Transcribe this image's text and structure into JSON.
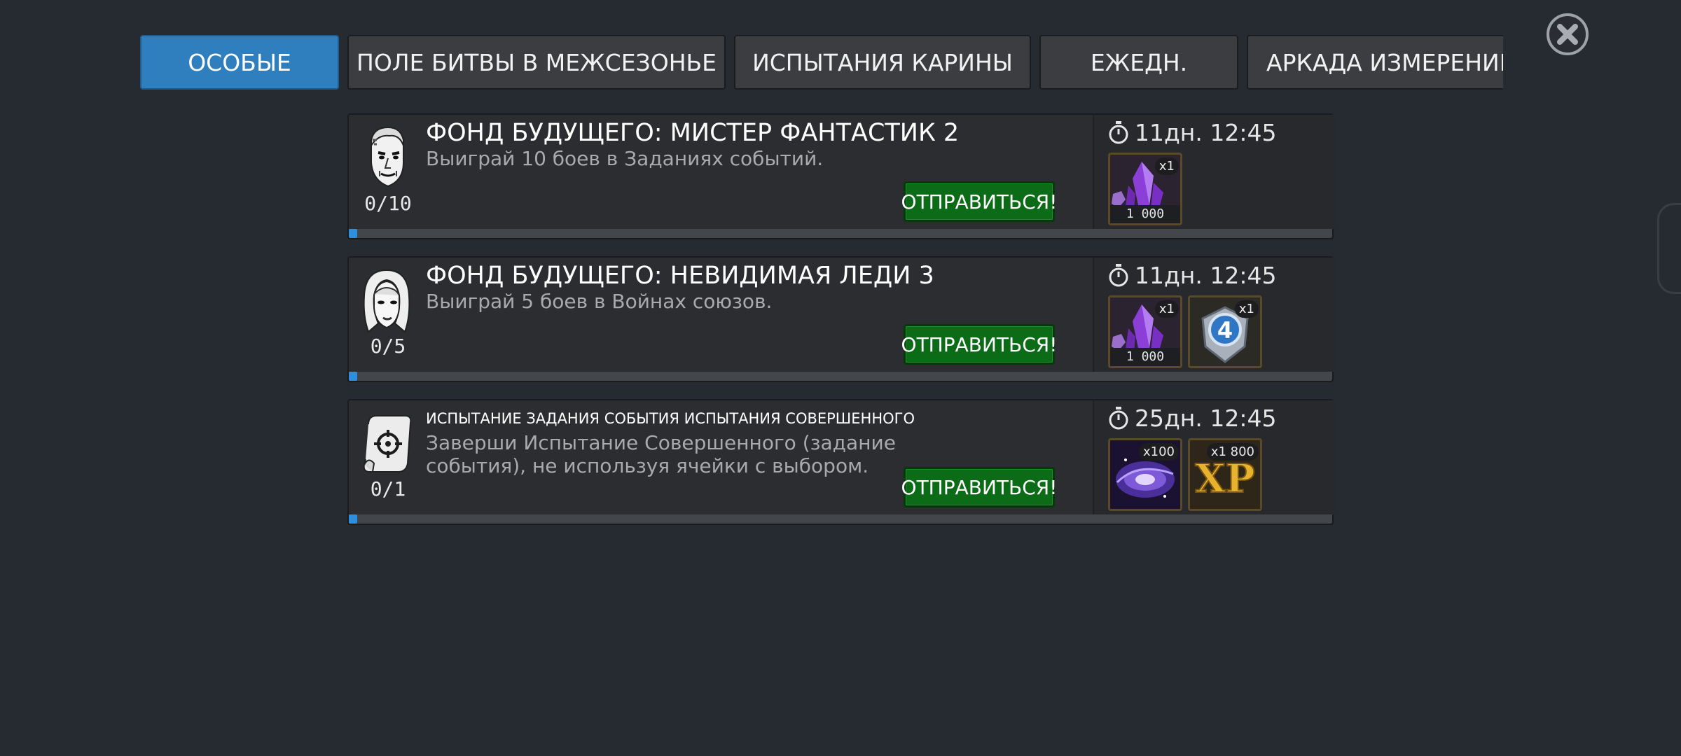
{
  "tabs": [
    {
      "label": "ОСОБЫЕ",
      "active": true
    },
    {
      "label": "ПОЛЕ БИТВЫ В МЕЖСЕЗОНЬЕ",
      "active": false
    },
    {
      "label": "ИСПЫТАНИЯ КАРИНЫ",
      "active": false
    },
    {
      "label": "ЕЖЕДН.",
      "active": false
    },
    {
      "label": "АРКАДА ИЗМЕРЕНИЙ",
      "active": false
    }
  ],
  "close_icon": "close-icon",
  "colors": {
    "accent": "#2f7fbf",
    "go_button": "#0c6b17",
    "progress": "#2d8fe0"
  },
  "quests": [
    {
      "title": "ФОНД БУДУЩЕГО: МИСТЕР ФАНТАСТИК 2",
      "description": "Выиграй 10 боев в Заданиях событий.",
      "progress": "0/10",
      "progress_fraction": 0.0,
      "go_label": "ОТПРАВИТЬСЯ!",
      "timer": "11дн. 12:45",
      "icon": "mister-fantastic-face-icon",
      "rewards": [
        {
          "icon": "purple-crystal-icon",
          "qty": "x1",
          "amount": "1 000"
        }
      ]
    },
    {
      "title": "ФОНД БУДУЩЕГО: НЕВИДИМАЯ ЛЕДИ 3",
      "description": "Выиграй 5 боев в Войнах союзов.",
      "progress": "0/5",
      "progress_fraction": 0.0,
      "go_label": "ОТПРАВИТЬСЯ!",
      "timer": "11дн. 12:45",
      "icon": "invisible-woman-face-icon",
      "rewards": [
        {
          "icon": "purple-crystal-icon",
          "qty": "x1",
          "amount": "1 000"
        },
        {
          "icon": "fantastic-four-badge-icon",
          "qty": "x1",
          "amount": ""
        }
      ]
    },
    {
      "title": "ИСПЫТАНИЕ ЗАДАНИЯ СОБЫТИЯ ИСПЫТАНИЯ СОВЕРШЕННОГО",
      "description": "Заверши Испытание Совершенного (задание события), не используя ячейки с выбором.",
      "progress": "0/1",
      "progress_fraction": 0.0,
      "go_label": "ОТПРАВИТЬСЯ!",
      "timer": "25дн. 12:45",
      "icon": "scroll-target-icon",
      "rewards": [
        {
          "icon": "galaxy-icon",
          "qty": "x100",
          "amount": ""
        },
        {
          "icon": "xp-gold-icon",
          "qty": "x1 800",
          "amount": ""
        }
      ]
    }
  ]
}
